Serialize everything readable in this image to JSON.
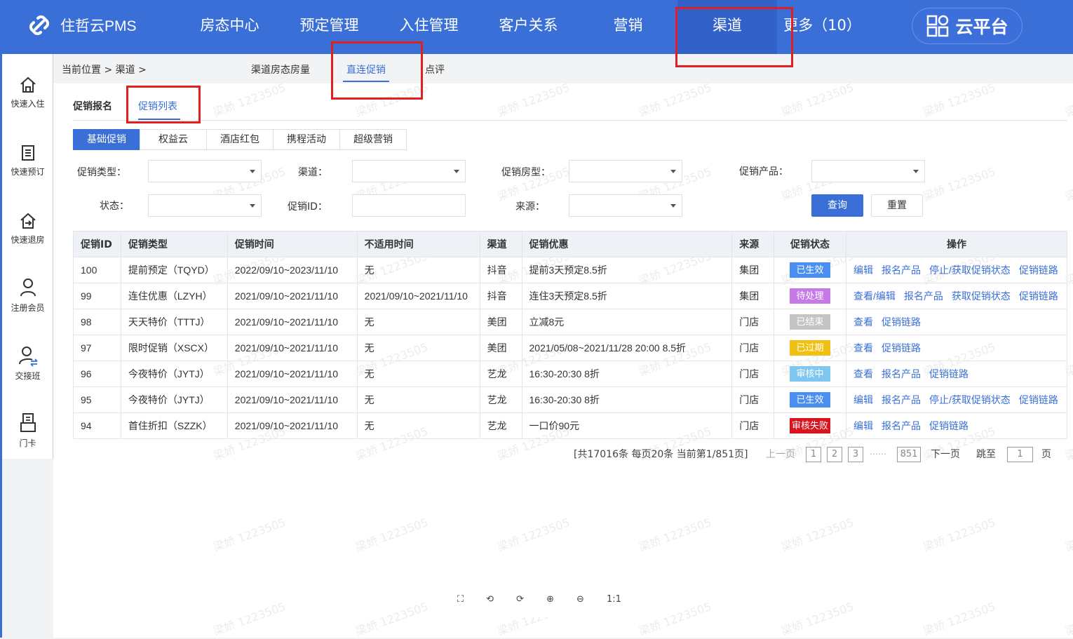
{
  "app": {
    "title": "住哲云PMS",
    "cloud_label": "云平台"
  },
  "nav": [
    {
      "label": "房态中心"
    },
    {
      "label": "预定管理"
    },
    {
      "label": "入住管理"
    },
    {
      "label": "客户关系"
    },
    {
      "label": "营销"
    },
    {
      "label": "渠道"
    },
    {
      "label": "更多（10）"
    }
  ],
  "sidebar": [
    {
      "label": "快速入住",
      "icon": "home-icon"
    },
    {
      "label": "快速预订",
      "icon": "document-icon"
    },
    {
      "label": "快速退房",
      "icon": "checkout-icon"
    },
    {
      "label": "注册会员",
      "icon": "user-icon"
    },
    {
      "label": "交接班",
      "icon": "user-swap-icon"
    },
    {
      "label": "门卡",
      "icon": "card-icon"
    }
  ],
  "breadcrumb": {
    "text": "当前位置 > 渠道 >"
  },
  "subtabs": [
    {
      "label": "渠道房态房量"
    },
    {
      "label": "直连促销"
    },
    {
      "label": "点评"
    }
  ],
  "panel_tabs": [
    {
      "label": "促销报名"
    },
    {
      "label": "促销列表"
    }
  ],
  "category_tabs": [
    {
      "label": "基础促销"
    },
    {
      "label": "权益云"
    },
    {
      "label": "酒店红包"
    },
    {
      "label": "携程活动"
    },
    {
      "label": "超级营销"
    }
  ],
  "filters": {
    "promo_type": "促销类型：",
    "channel": "渠道：",
    "room_type": "促销房型：",
    "product": "促销产品：",
    "status": "状态：",
    "promo_id": "促销ID：",
    "source": "来源：",
    "query": "查询",
    "reset": "重置"
  },
  "table": {
    "headers": [
      "促销ID",
      "促销类型",
      "促销时间",
      "不适用时间",
      "渠道",
      "促销优惠",
      "来源",
      "促销状态",
      "操作"
    ],
    "rows": [
      {
        "id": "100",
        "type": "提前预定（TQYD）",
        "time": "2022/09/10~2023/11/10",
        "excl": "无",
        "channel": "抖音",
        "offer": "提前3天预定8.5折",
        "source": "集团",
        "status": "已生效",
        "color": "#4a8ef0",
        "ops": [
          "编辑",
          "报名产品",
          "停止/获取促销状态",
          "促销链路"
        ]
      },
      {
        "id": "99",
        "type": "连住优惠（LZYH）",
        "time": "2021/09/10~2021/11/10",
        "excl": "2021/09/10~2021/11/10",
        "channel": "抖音",
        "offer": "连住3天预定8.5折",
        "source": "集团",
        "status": "待处理",
        "color": "#c57ae8",
        "ops": [
          "查看/编辑",
          "报名产品",
          "获取促销状态",
          "促销链路"
        ]
      },
      {
        "id": "98",
        "type": "天天特价（TTTJ）",
        "time": "2021/09/10~2021/11/10",
        "excl": "无",
        "channel": "美团",
        "offer": "立减8元",
        "source": "门店",
        "status": "已结束",
        "color": "#c4c4c4",
        "ops": [
          "查看",
          "促销链路"
        ]
      },
      {
        "id": "97",
        "type": "限时促销（XSCX）",
        "time": "2021/09/10~2021/11/10",
        "excl": "无",
        "channel": "美团",
        "offer": "2021/05/08~2021/11/28  20:00  8.5折",
        "source": "门店",
        "status": "已过期",
        "color": "#f2c012",
        "ops": [
          "查看",
          "促销链路"
        ]
      },
      {
        "id": "96",
        "type": "今夜特价（JYTJ）",
        "time": "2021/09/10~2021/11/10",
        "excl": "无",
        "channel": "艺龙",
        "offer": "16:30-20:30  8折",
        "source": "门店",
        "status": "审核中",
        "color": "#7fc7f0",
        "ops": [
          "查看",
          "报名产品",
          "促销链路"
        ]
      },
      {
        "id": "95",
        "type": "今夜特价（JYTJ）",
        "time": "2021/09/10~2021/11/10",
        "excl": "无",
        "channel": "艺龙",
        "offer": "16:30-20:30  8折",
        "source": "门店",
        "status": "已生效",
        "color": "#4a8ef0",
        "ops": [
          "编辑",
          "报名产品",
          "停止/获取促销状态",
          "促销链路"
        ]
      },
      {
        "id": "94",
        "type": "首住折扣（SZZK）",
        "time": "2021/09/10~2021/11/10",
        "excl": "无",
        "channel": "艺龙",
        "offer": "一口价90元",
        "source": "门店",
        "status": "审核失败",
        "color": "#d9141e",
        "ops": [
          "编辑",
          "报名产品",
          "促销链路"
        ]
      }
    ]
  },
  "pager": {
    "summary": "[共17016条  每页20条  当前第1/851页]",
    "prev": "上一页",
    "pages": [
      "1",
      "2",
      "3"
    ],
    "ellipsis": "……",
    "last": "851",
    "next": "下一页",
    "jump": "跳至",
    "jump_value": "1",
    "page_unit": "页"
  },
  "watermark": "梁娇 1223505",
  "viewer_tools": [
    "⛶",
    "⟲",
    "⟳",
    "⊕",
    "⊖",
    "1:1"
  ]
}
